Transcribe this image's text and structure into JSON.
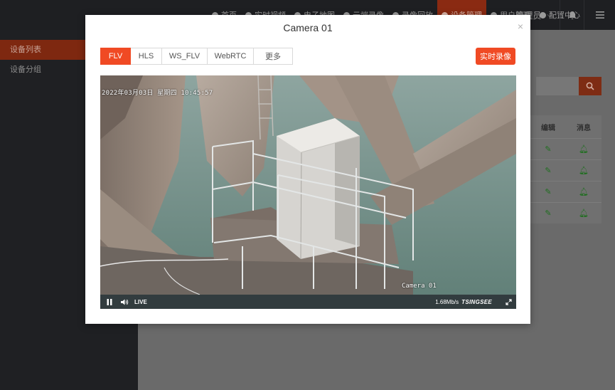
{
  "topbar": {
    "nav_items": [
      {
        "label": "首页",
        "active": false
      },
      {
        "label": "实时视频",
        "active": false
      },
      {
        "label": "电子地图",
        "active": false
      },
      {
        "label": "云端录像",
        "active": false
      },
      {
        "label": "录像回放",
        "active": false
      },
      {
        "label": "设备管理",
        "active": true
      },
      {
        "label": "用户管理",
        "active": false
      },
      {
        "label": "配置中心",
        "active": false
      }
    ],
    "user_label": "管理员",
    "user_chevron": "⌵"
  },
  "sidebar": {
    "items": [
      {
        "label": "设备列表",
        "active": true
      },
      {
        "label": "设备分组",
        "active": false
      }
    ]
  },
  "background_table": {
    "headers": [
      "编辑",
      "消息"
    ],
    "row_count": 4
  },
  "modal": {
    "title": "Camera 01",
    "close_symbol": "×",
    "tabs": [
      {
        "label": "FLV",
        "active": true
      },
      {
        "label": "HLS",
        "active": false
      },
      {
        "label": "WS_FLV",
        "active": false
      },
      {
        "label": "WebRTC",
        "active": false
      },
      {
        "label": "更多",
        "active": false
      }
    ],
    "record_button": "实时录像"
  },
  "player": {
    "osd_timestamp": "2022年03月03日  星期四  10:45:57",
    "osd_camera_name": "Camera 01",
    "live_label": "LIVE",
    "bitrate": "1.68Mb/s",
    "brand": "TSINGSEE"
  },
  "colors": {
    "accent": "#f04a24",
    "topbar_bg": "#1e1f22",
    "sidebar_bg": "#1f2023"
  }
}
